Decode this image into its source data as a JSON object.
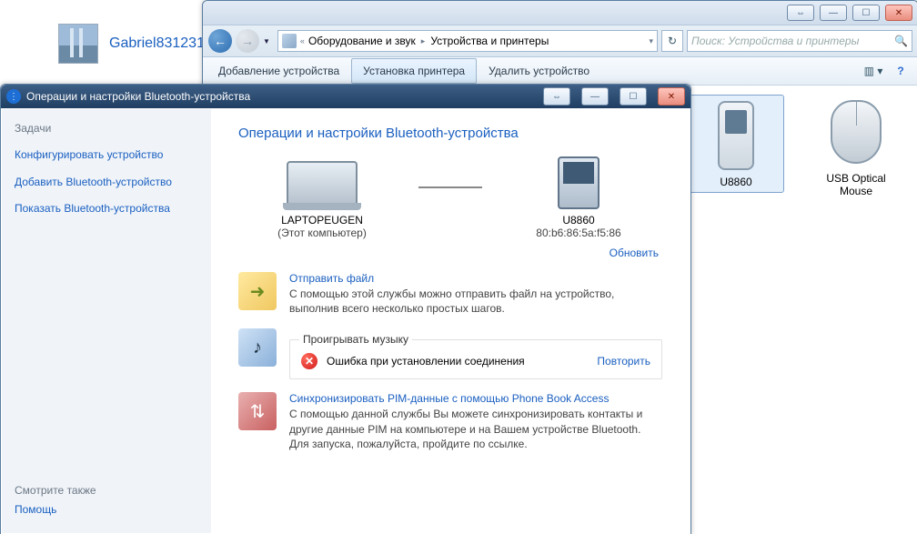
{
  "user": {
    "name": "Gabriel831231"
  },
  "explorer": {
    "caption_buttons": {
      "prev": "⇔",
      "min": "—",
      "max": "☐",
      "close": "✕"
    },
    "addressbar": {
      "icon_name": "devices-printers-icon",
      "chevrons": "«",
      "crumbs": [
        "Оборудование и звук",
        "Устройства и принтеры"
      ],
      "refresh_label": "↻"
    },
    "search": {
      "placeholder": "Поиск: Устройства и принтеры",
      "icon": "🔍"
    },
    "commandbar": {
      "add_device": "Добавление устройства",
      "add_printer": "Установка принтера",
      "remove_device": "Удалить устройство",
      "view_menu": "▥ ▾",
      "help": "?"
    },
    "devices": {
      "phone": {
        "name": "U8860"
      },
      "mouse": {
        "name": "USB Optical Mouse"
      }
    }
  },
  "bt": {
    "title": "Операции и настройки Bluetooth-устройства",
    "caption_buttons": {
      "prev": "⇔",
      "min": "—",
      "max": "☐",
      "close": "✕"
    },
    "sidebar": {
      "tasks_header": "Задачи",
      "configure": "Конфигурировать устройство",
      "add": "Добавить Bluetooth-устройство",
      "show": "Показать Bluetooth-устройства",
      "see_also": "Смотрите также",
      "help": "Помощь"
    },
    "heading": "Операции и настройки Bluetooth-устройства",
    "pair": {
      "laptop": {
        "name": "LAPTOPEUGEN",
        "sub": "(Этот компьютер)"
      },
      "phone": {
        "name": "U8860",
        "sub": "80:b6:86:5a:f5:86"
      }
    },
    "update_link": "Обновить",
    "send_file": {
      "title": "Отправить файл",
      "desc": "С помощью этой службы можно отправить файл на устройство, выполнив всего несколько простых шагов."
    },
    "music": {
      "box_title": "Проигрывать музыку",
      "error": "Ошибка при установлении соединения",
      "retry": "Повторить"
    },
    "pim": {
      "title": "Синхронизировать PIM-данные с помощью Phone Book Access",
      "desc": "С помощью данной службы Вы можете синхронизировать контакты и другие данные PIM на компьютере и на Вашем устройстве Bluetooth. Для запуска, пожалуйста, пройдите по ссылке."
    }
  }
}
